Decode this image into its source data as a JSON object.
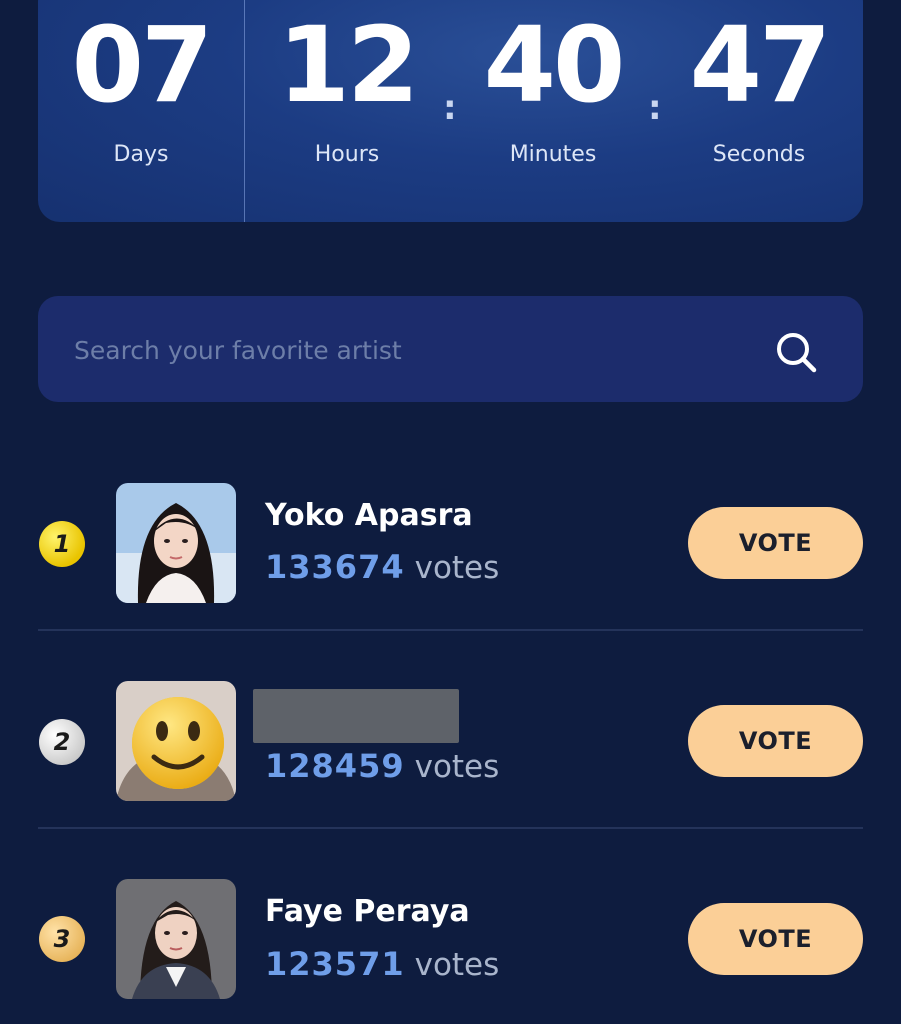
{
  "countdown": {
    "units": [
      {
        "value": "07",
        "label": "Days"
      },
      {
        "value": "12",
        "label": "Hours"
      },
      {
        "value": "40",
        "label": "Minutes"
      },
      {
        "value": "47",
        "label": "Seconds"
      }
    ],
    "separator": ":"
  },
  "search": {
    "placeholder": "Search your favorite artist",
    "icon": "search-icon"
  },
  "artists": [
    {
      "rank": "1",
      "name": "Yoko Apasra",
      "votes": "133674",
      "votes_unit": "votes",
      "button": "VOTE",
      "badge_color": "#f1d20f"
    },
    {
      "rank": "2",
      "name": "",
      "name_redacted": true,
      "votes": "128459",
      "votes_unit": "votes",
      "button": "VOTE",
      "badge_color": "#e6e6e6",
      "avatar_icon": "smiley-emoji-icon"
    },
    {
      "rank": "3",
      "name": "Faye Peraya",
      "votes": "123571",
      "votes_unit": "votes",
      "button": "VOTE",
      "badge_color": "#f4c77a"
    }
  ],
  "colors": {
    "background": "#0e1c3f",
    "countdown_panel": "#1c3c83",
    "search_panel": "#1c2c6c",
    "vote_count": "#6f9ee9",
    "vote_button": "#fbcf97"
  }
}
